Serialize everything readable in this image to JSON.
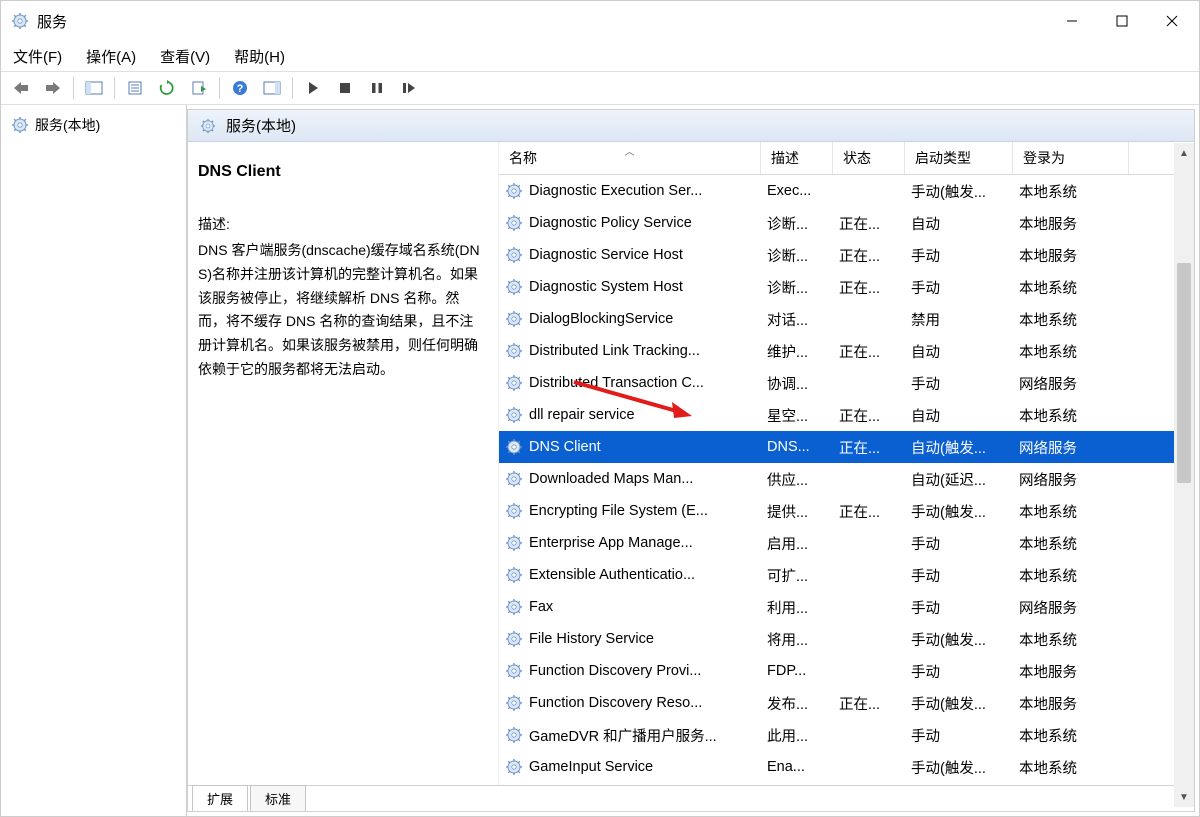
{
  "window_title": "服务",
  "menubar": {
    "file": "文件(F)",
    "action": "操作(A)",
    "view": "查看(V)",
    "help": "帮助(H)"
  },
  "tree": {
    "root_label": "服务(本地)"
  },
  "header": {
    "label": "服务(本地)"
  },
  "detail": {
    "title": "DNS Client",
    "desc_label": "描述:",
    "desc_body": "DNS 客户端服务(dnscache)缓存域名系统(DNS)名称并注册该计算机的完整计算机名。如果该服务被停止，将继续解析 DNS 名称。然而，将不缓存 DNS 名称的查询结果，且不注册计算机名。如果该服务被禁用，则任何明确依赖于它的服务都将无法启动。"
  },
  "columns": {
    "name": "名称",
    "desc": "描述",
    "state": "状态",
    "start": "启动类型",
    "logon": "登录为"
  },
  "services": [
    {
      "name": "Diagnostic Execution Ser...",
      "desc": "Exec...",
      "state": "",
      "start": "手动(触发...",
      "logon": "本地系统"
    },
    {
      "name": "Diagnostic Policy Service",
      "desc": "诊断...",
      "state": "正在...",
      "start": "自动",
      "logon": "本地服务"
    },
    {
      "name": "Diagnostic Service Host",
      "desc": "诊断...",
      "state": "正在...",
      "start": "手动",
      "logon": "本地服务"
    },
    {
      "name": "Diagnostic System Host",
      "desc": "诊断...",
      "state": "正在...",
      "start": "手动",
      "logon": "本地系统"
    },
    {
      "name": "DialogBlockingService",
      "desc": "对话...",
      "state": "",
      "start": "禁用",
      "logon": "本地系统"
    },
    {
      "name": "Distributed Link Tracking...",
      "desc": "维护...",
      "state": "正在...",
      "start": "自动",
      "logon": "本地系统"
    },
    {
      "name": "Distributed Transaction C...",
      "desc": "协调...",
      "state": "",
      "start": "手动",
      "logon": "网络服务"
    },
    {
      "name": "dll repair service",
      "desc": "星空...",
      "state": "正在...",
      "start": "自动",
      "logon": "本地系统"
    },
    {
      "name": "DNS Client",
      "desc": "DNS...",
      "state": "正在...",
      "start": "自动(触发...",
      "logon": "网络服务",
      "selected": true
    },
    {
      "name": "Downloaded Maps Man...",
      "desc": "供应...",
      "state": "",
      "start": "自动(延迟...",
      "logon": "网络服务"
    },
    {
      "name": "Encrypting File System (E...",
      "desc": "提供...",
      "state": "正在...",
      "start": "手动(触发...",
      "logon": "本地系统"
    },
    {
      "name": "Enterprise App Manage...",
      "desc": "启用...",
      "state": "",
      "start": "手动",
      "logon": "本地系统"
    },
    {
      "name": "Extensible Authenticatio...",
      "desc": "可扩...",
      "state": "",
      "start": "手动",
      "logon": "本地系统"
    },
    {
      "name": "Fax",
      "desc": "利用...",
      "state": "",
      "start": "手动",
      "logon": "网络服务"
    },
    {
      "name": "File History Service",
      "desc": "将用...",
      "state": "",
      "start": "手动(触发...",
      "logon": "本地系统"
    },
    {
      "name": "Function Discovery Provi...",
      "desc": "FDP...",
      "state": "",
      "start": "手动",
      "logon": "本地服务"
    },
    {
      "name": "Function Discovery Reso...",
      "desc": "发布...",
      "state": "正在...",
      "start": "手动(触发...",
      "logon": "本地服务"
    },
    {
      "name": "GameDVR 和广播用户服务...",
      "desc": "此用...",
      "state": "",
      "start": "手动",
      "logon": "本地系统"
    },
    {
      "name": "GameInput Service",
      "desc": "Ena...",
      "state": "",
      "start": "手动(触发...",
      "logon": "本地系统"
    }
  ],
  "tabs": {
    "extended": "扩展",
    "standard": "标准"
  }
}
